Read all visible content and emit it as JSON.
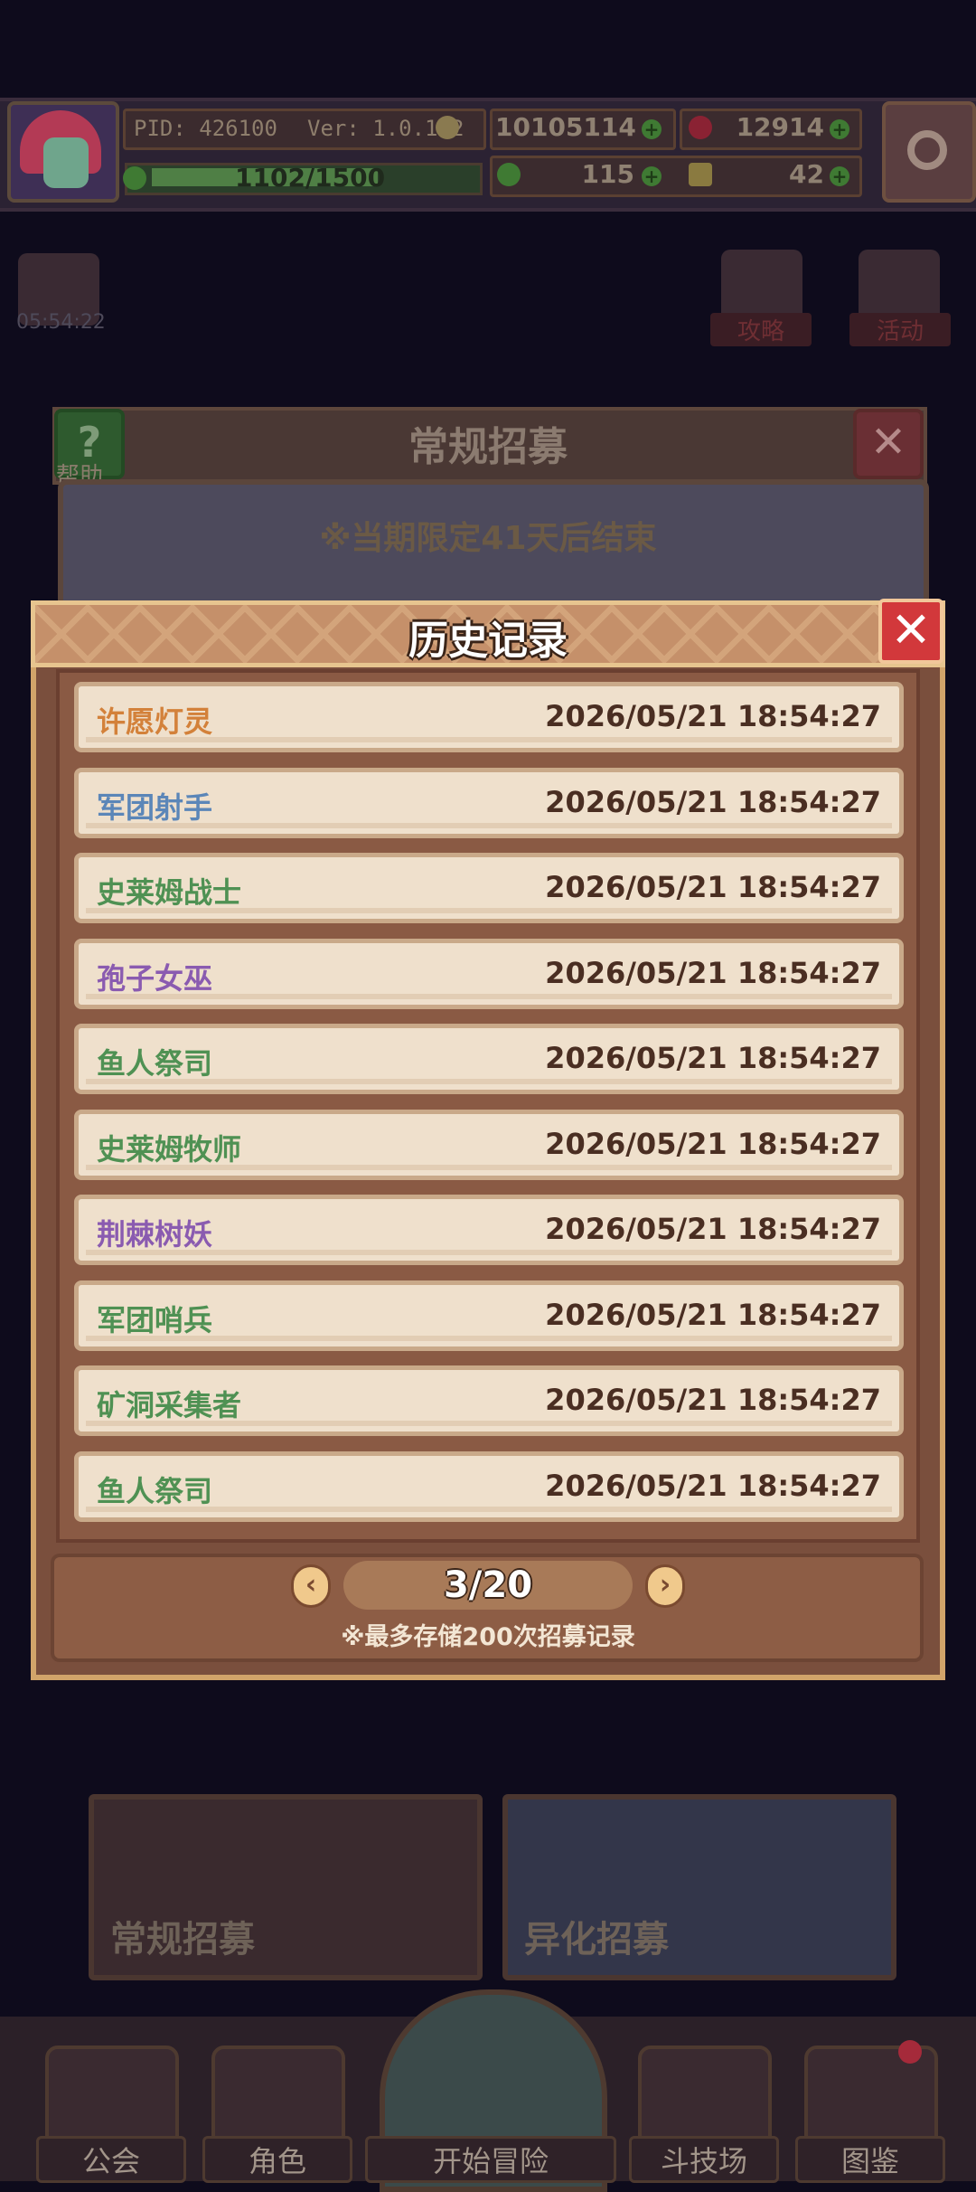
{
  "hud": {
    "pid": "PID: 426100",
    "version": "Ver: 1.0.1.2",
    "gold": "10105114",
    "gems": "12914",
    "energy": "1102/1500",
    "clover": "115",
    "ticket": "42"
  },
  "side": {
    "timer": "05:54:22",
    "guide": "攻略",
    "event": "活动"
  },
  "banner": {
    "title": "常规招募",
    "help": "帮助",
    "notice": "※当期限定41天后结束"
  },
  "history": {
    "title": "历史记录",
    "close_icon": "close-icon",
    "records": [
      {
        "name": "许愿灯灵",
        "time": "2026/05/21 18:54:27",
        "color": "#d3813a"
      },
      {
        "name": "军团射手",
        "time": "2026/05/21 18:54:27",
        "color": "#5b86b8"
      },
      {
        "name": "史莱姆战士",
        "time": "2026/05/21 18:54:27",
        "color": "#4f9153"
      },
      {
        "name": "孢子女巫",
        "time": "2026/05/21 18:54:27",
        "color": "#8a5bb0"
      },
      {
        "name": "鱼人祭司",
        "time": "2026/05/21 18:54:27",
        "color": "#4f9153"
      },
      {
        "name": "史莱姆牧师",
        "time": "2026/05/21 18:54:27",
        "color": "#4f9153"
      },
      {
        "name": "荆棘树妖",
        "time": "2026/05/21 18:54:27",
        "color": "#8a5bb0"
      },
      {
        "name": "军团哨兵",
        "time": "2026/05/21 18:54:27",
        "color": "#4f9153"
      },
      {
        "name": "矿洞采集者",
        "time": "2026/05/21 18:54:27",
        "color": "#4f9153"
      },
      {
        "name": "鱼人祭司",
        "time": "2026/05/21 18:54:27",
        "color": "#4f9153"
      }
    ],
    "page": "3/20",
    "note": "※最多存储200次招募记录"
  },
  "recruit_tabs": {
    "normal": "常规招募",
    "mutant": "异化招募"
  },
  "nav": {
    "guild": "公会",
    "role": "角色",
    "adventure": "开始冒险",
    "arena": "斗技场",
    "codex": "图鉴"
  }
}
